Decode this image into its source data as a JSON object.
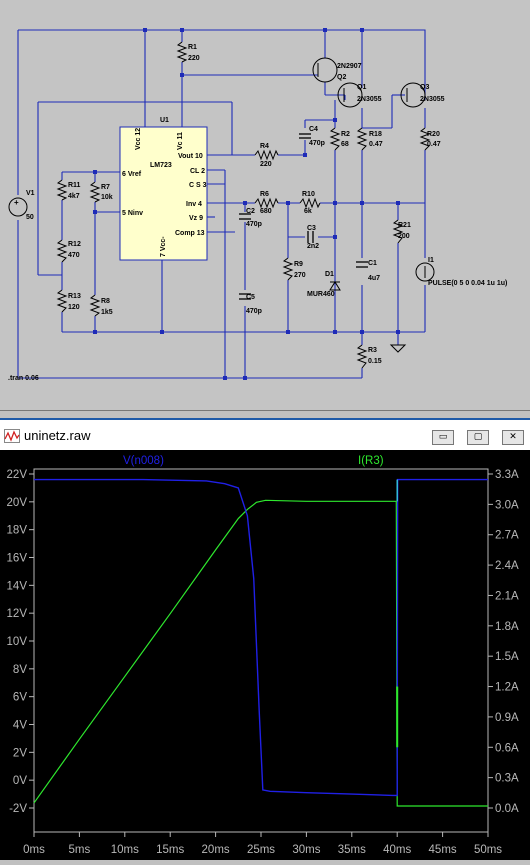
{
  "schematic": {
    "tran_directive": ".tran 0.06",
    "components": {
      "u1_ref": "U1",
      "u1_model": "LM723",
      "pins": [
        "Vcc 12",
        "Vc 11",
        "Vout 10",
        "CL 2",
        "C S 3",
        "6 Vref",
        "5 Ninv",
        "Inv 4",
        "Vz 9",
        "Comp 13",
        "7 Vcc-"
      ],
      "r1": [
        "R1",
        "220"
      ],
      "r2": [
        "R2",
        "68"
      ],
      "r3": [
        "R3",
        "0.15"
      ],
      "r4": [
        "R4",
        "220"
      ],
      "r6": [
        "R6",
        "680"
      ],
      "r7": [
        "R7",
        "10k"
      ],
      "r8": [
        "R8",
        "1k5"
      ],
      "r9": [
        "R9",
        "270"
      ],
      "r10": [
        "R10",
        "6k"
      ],
      "r11": [
        "R11",
        "4k7"
      ],
      "r12": [
        "R12",
        "470"
      ],
      "r13": [
        "R13",
        "120"
      ],
      "r18": [
        "R18",
        "0.47"
      ],
      "r20": [
        "R20",
        "0.47"
      ],
      "r21": [
        "R21",
        "200"
      ],
      "c1": [
        "C1",
        "4u7"
      ],
      "c2": [
        "C2",
        "470p"
      ],
      "c3": [
        "C3",
        "2n2"
      ],
      "c4": [
        "C4",
        "470p"
      ],
      "c5": [
        "C5",
        "470p"
      ],
      "d1": [
        "D1",
        "MUR460"
      ],
      "v1": [
        "V1",
        "50"
      ],
      "i1": [
        "I1",
        "PULSE(0 5 0 0.04 1u 1u)"
      ],
      "q1": [
        "Q1",
        "2N3055"
      ],
      "q2": [
        "2N2907",
        "Q2"
      ],
      "q3": [
        "Q3",
        "2N3055"
      ]
    }
  },
  "waveform_window": {
    "title": "uninetz.raw",
    "title_icon": "waveform-icon",
    "buttons": {
      "minimize": "▭",
      "restore": "▢",
      "close": "✕"
    }
  },
  "colors": {
    "vtrace": "#2020e6",
    "itrace": "#2ee82e",
    "ctrace": "#33c8e0",
    "axis": "#b8b8b8",
    "plot_bg": "#000000"
  },
  "chart_data": {
    "type": "line",
    "x_ticks": [
      "0ms",
      "5ms",
      "10ms",
      "15ms",
      "20ms",
      "25ms",
      "30ms",
      "35ms",
      "40ms",
      "45ms",
      "50ms"
    ],
    "y_left_ticks": [
      "22V",
      "20V",
      "18V",
      "16V",
      "14V",
      "12V",
      "10V",
      "8V",
      "6V",
      "4V",
      "2V",
      "0V",
      "-2V"
    ],
    "y_right_ticks": [
      "3.3A",
      "3.0A",
      "2.7A",
      "2.4A",
      "2.1A",
      "1.8A",
      "1.5A",
      "1.2A",
      "0.9A",
      "0.6A",
      "0.3A",
      "0.0A"
    ],
    "xlim": [
      0,
      50
    ],
    "ylim_left": [
      -2,
      22
    ],
    "ylim_right": [
      0,
      3.3
    ],
    "series": [
      {
        "name": "V(n008)",
        "axis": "left",
        "x": [
          0,
          12,
          19,
          21,
          22.5,
          23.5,
          24.2,
          24.8,
          25.2,
          26,
          30,
          35,
          39.5,
          40,
          40.05,
          45,
          50
        ],
        "y": [
          21.6,
          21.6,
          21.5,
          21.3,
          21.0,
          19.0,
          14.5,
          5.0,
          -0.7,
          -0.8,
          -0.9,
          -1.0,
          -1.1,
          -1.1,
          21.6,
          21.6,
          21.6
        ]
      },
      {
        "name": "I(R3)",
        "axis": "right",
        "x": [
          0,
          5,
          10,
          15,
          20,
          22.5,
          23.5,
          24.5,
          25.5,
          30,
          35,
          39.9,
          40,
          40.1,
          45,
          50
        ],
        "y": [
          0.05,
          0.68,
          1.3,
          1.92,
          2.55,
          2.86,
          2.95,
          3.02,
          3.04,
          3.03,
          3.03,
          3.03,
          0.02,
          0.02,
          0.02,
          0.02
        ]
      }
    ]
  }
}
